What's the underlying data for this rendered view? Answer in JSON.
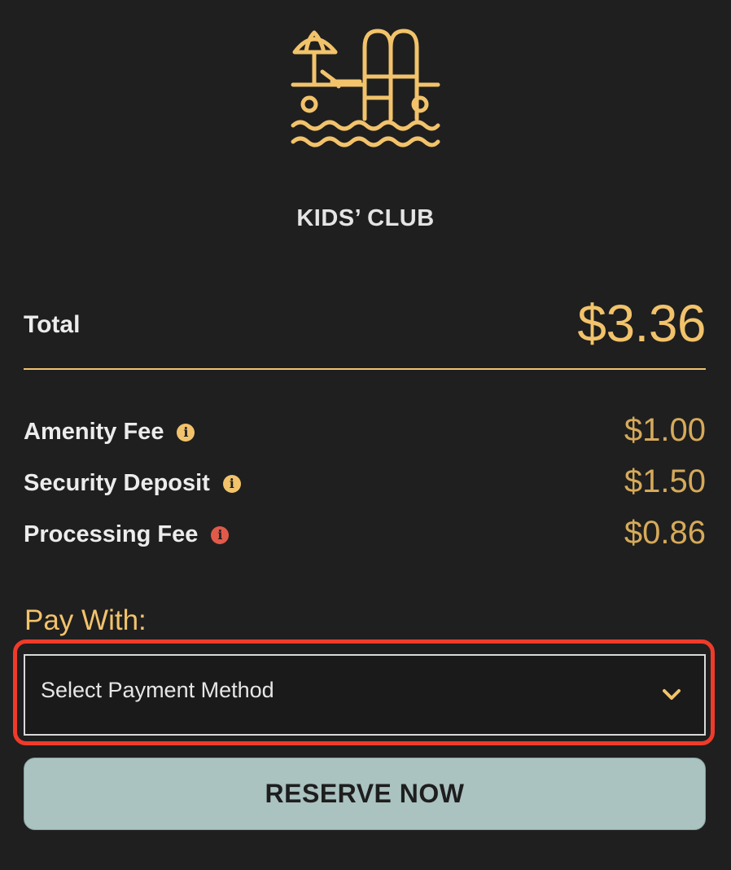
{
  "amenity": {
    "icon": "pool-icon",
    "title": "KIDS’ CLUB"
  },
  "summary": {
    "total_label": "Total",
    "total_value": "$3.36"
  },
  "fees": [
    {
      "label": "Amenity Fee",
      "value": "$1.00",
      "info_icon": "info-icon",
      "info_color": "#f2c36b"
    },
    {
      "label": "Security Deposit",
      "value": "$1.50",
      "info_icon": "info-icon",
      "info_color": "#f2c36b"
    },
    {
      "label": "Processing Fee",
      "value": "$0.86",
      "info_icon": "info-icon",
      "info_color": "#e05a4a"
    }
  ],
  "payment": {
    "label": "Pay With:",
    "select_placeholder": "Select Payment Method",
    "chevron_icon": "chevron-down-icon"
  },
  "actions": {
    "reserve_label": "RESERVE NOW"
  },
  "colors": {
    "background": "#1f1f1f",
    "accent": "#f2c36b",
    "highlight": "#ef3b2a",
    "button": "#aac2c0"
  }
}
